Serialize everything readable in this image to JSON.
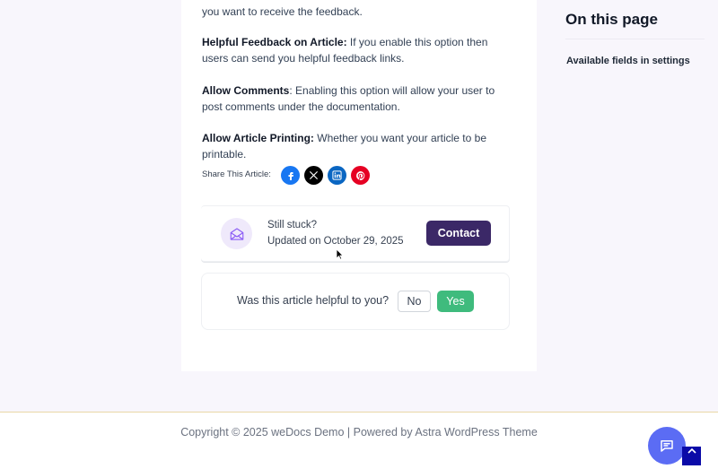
{
  "article": {
    "paragraphs": [
      {
        "bold": "",
        "text": "you want to receive the feedback."
      },
      {
        "bold": "Helpful Feedback on Article:",
        "text": " If you enable this option then users can send you helpful feedback links."
      },
      {
        "bold": "Allow Comments",
        "text": ": Enabling this option will allow your user to post comments under the documentation."
      },
      {
        "bold": "Allow Article Printing:",
        "text": " Whether you want your article to be printable."
      }
    ]
  },
  "share": {
    "label": "Share This Article:",
    "buttons": [
      {
        "name": "facebook",
        "color": "#1877f2",
        "icon": "facebook-icon"
      },
      {
        "name": "x",
        "color": "#000000",
        "icon": "x-icon"
      },
      {
        "name": "linkedin",
        "color": "#0a66c2",
        "icon": "linkedin-icon"
      },
      {
        "name": "pinterest",
        "color": "#e60023",
        "icon": "pinterest-icon"
      }
    ]
  },
  "contact_card": {
    "icon": "envelope-open-icon",
    "title": "Still stuck?",
    "updated": "Updated on October 29, 2025",
    "button_label": "Contact",
    "button_color": "#3b2867"
  },
  "feedback": {
    "question": "Was this article helpful to you?",
    "no_label": "No",
    "yes_label": "Yes",
    "yes_color": "#3fbb7d"
  },
  "toc": {
    "title": "On this page",
    "items": [
      "Available fields in settings"
    ]
  },
  "footer": {
    "copyright": "Copyright © 2025 weDocs Demo | Powered by Astra WordPress Theme"
  },
  "floating": {
    "chat_icon": "chat-bubble-icon",
    "chat_color": "#5b6cf4",
    "scroll_top_icon": "chevron-up-icon",
    "scroll_top_color": "#0a0aa8"
  }
}
